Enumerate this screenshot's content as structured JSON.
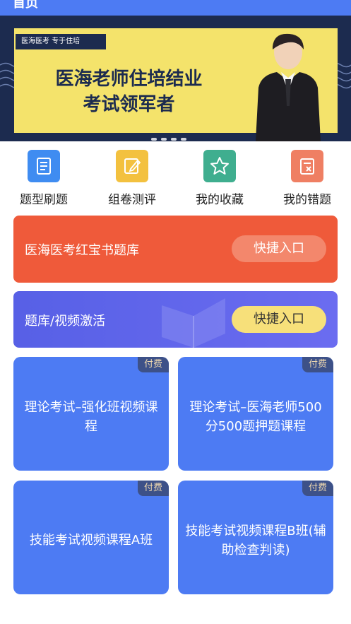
{
  "header": {
    "partial_title": "首页"
  },
  "banner": {
    "tag": "医海医考  专于住培",
    "headline_line1": "医海老师住培结业",
    "headline_line2": "考试领军者"
  },
  "quick_menu": [
    {
      "label": "题型刷题",
      "icon": "document-icon",
      "color": "#3f8cf1"
    },
    {
      "label": "组卷测评",
      "icon": "edit-icon",
      "color": "#f3c13f"
    },
    {
      "label": "我的收藏",
      "icon": "star-icon",
      "color": "#3fae8f"
    },
    {
      "label": "我的错题",
      "icon": "wrong-notes-icon",
      "color": "#ef7f63"
    }
  ],
  "red_card": {
    "title": "医海医考红宝书题库",
    "button": "快捷入口",
    "color": "#ef5a3a"
  },
  "activation_card": {
    "title": "题库/视频激活",
    "button": "快捷入口",
    "color": "#6064e8"
  },
  "courses": [
    {
      "badge": "付费",
      "title": "理论考试–强化班视频课程"
    },
    {
      "badge": "付费",
      "title": "理论考试–医海老师500分500题押题课程"
    },
    {
      "badge": "付费",
      "title": "技能考试视频课程A班"
    },
    {
      "badge": "付费",
      "title": "技能考试视频课程B班(辅助检查判读)"
    }
  ]
}
